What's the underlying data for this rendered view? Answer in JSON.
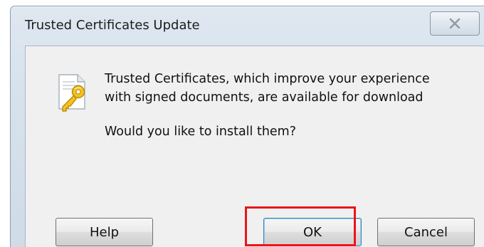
{
  "window": {
    "title": "Trusted Certificates Update"
  },
  "message": {
    "line1": "Trusted Certificates, which improve your experience",
    "line2": "with signed documents, are available for download",
    "question": "Would you like to install them?"
  },
  "buttons": {
    "help": "Help",
    "ok": "OK",
    "cancel": "Cancel"
  },
  "icons": {
    "dialog": "certificate-key-icon",
    "close": "close-icon"
  },
  "colors": {
    "highlight": "#e8161a",
    "title_bar": "#d6e1ec",
    "content_bg": "#f0f0f0"
  }
}
